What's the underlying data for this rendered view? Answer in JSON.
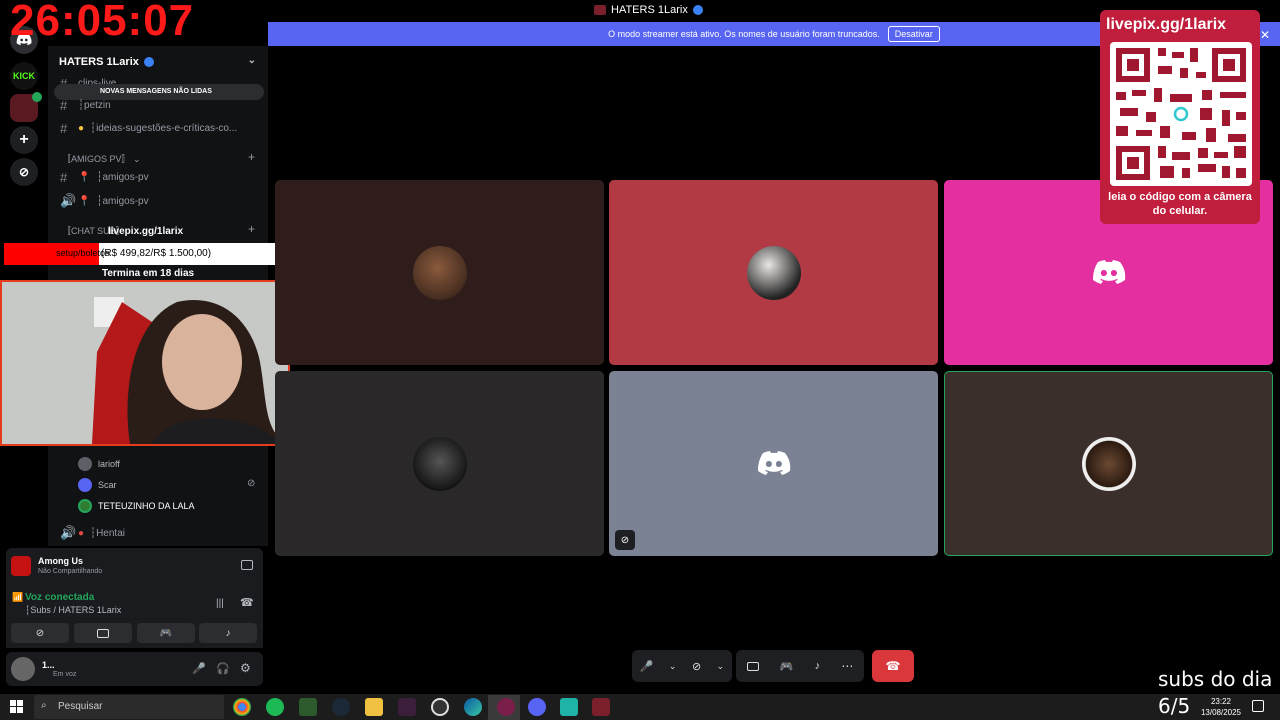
{
  "window": {
    "title": "HATERS 1Larix"
  },
  "banner": {
    "text": "O modo streamer está ativo. Os nomes de usuário foram truncados.",
    "button": "Desativar"
  },
  "timer": "26:05:07",
  "rail": {
    "kick_label": "KICK"
  },
  "server": {
    "name": "HATERS 1Larix"
  },
  "sidebar": {
    "unread_pill": "NOVAS MENSAGENS NÃO LIDAS",
    "channels_top": [
      {
        "name": "clips-live"
      },
      {
        "name": "┆petzin"
      },
      {
        "name": "┆ideias-sugestões-e-críticas-co..."
      }
    ],
    "category_amigos": "〚AMIGOS PV〛",
    "amigos_channels": [
      {
        "name": "┆amigos-pv"
      },
      {
        "name": "┆amigos-pv"
      }
    ],
    "category_chat": "〚CHAT SUB〛",
    "voice_users": [
      {
        "name": "larioff"
      },
      {
        "name": "Scar"
      },
      {
        "name": "TETEUZINHO DA LALA"
      }
    ],
    "hentai_channel": "┆Hentai"
  },
  "overlay": {
    "livepix_line": "livepix.gg/1larix",
    "goal_label": "setup/boletos",
    "goal_text": "(R$ 499,82/R$ 1.500,00)",
    "goal_progress": 0.333,
    "goal_end": "Termina em 18 dias"
  },
  "activity": {
    "game": "Among Us",
    "status": "Não Compartilhando"
  },
  "voice_panel": {
    "status": "Voz conectada",
    "channel": "┆Subs / HATERS 1Larix"
  },
  "user_panel": {
    "name": "1...",
    "status": "Em voz"
  },
  "qr": {
    "url": "livepix.gg/1larix",
    "caption": "leia o código com a câmera do celular."
  },
  "subs": {
    "label": "subs do dia",
    "count": "6/5"
  },
  "taskbar": {
    "search_placeholder": "Pesquisar",
    "time": "23:22",
    "date": "13/08/2025"
  },
  "colors": {
    "blurple": "#5865f2",
    "tile_dark_brown": "#2e1d1a",
    "tile_red": "#b13a44",
    "tile_pink": "#e32fa0",
    "tile_gray": "#2a2828",
    "tile_slate": "#7b8294",
    "tile_brown": "#3b2f2c",
    "hangup": "#da373c"
  }
}
